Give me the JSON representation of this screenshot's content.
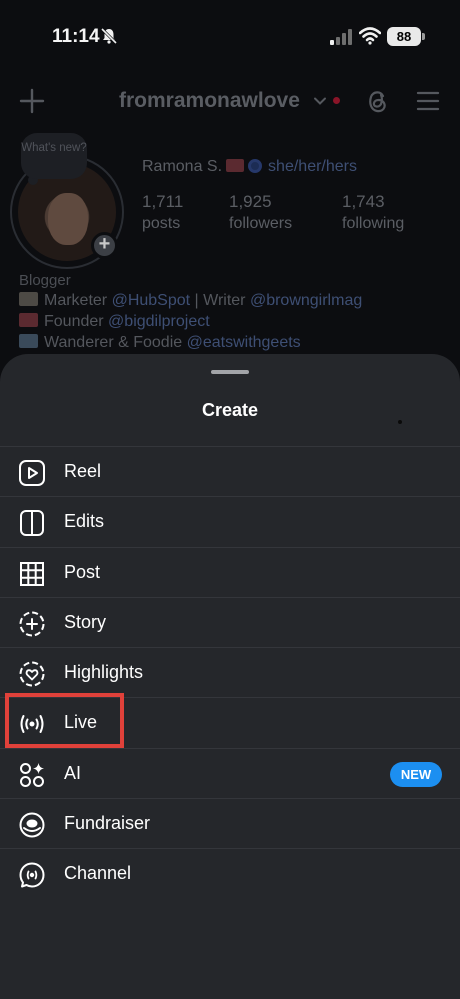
{
  "status_bar": {
    "time": "11:14",
    "battery": "88"
  },
  "profile": {
    "username": "fromramonawlove",
    "note_placeholder": "What's new?",
    "name": "Ramona S.",
    "pronouns": "she/her/hers",
    "stats": [
      {
        "value": "1,711",
        "label": "posts"
      },
      {
        "value": "1,925",
        "label": "followers"
      },
      {
        "value": "1,743",
        "label": "following"
      }
    ],
    "bio_category": "Blogger",
    "bio_lines": [
      {
        "text": "Marketer ",
        "mention": "@HubSpot",
        "rest": " | Writer ",
        "mention2": "@browngirlmag"
      },
      {
        "text": "Founder ",
        "mention": "@bigdilproject"
      },
      {
        "text": "Wanderer & Foodie ",
        "mention": "@eatswithgeets"
      }
    ]
  },
  "sheet": {
    "title": "Create",
    "items": [
      {
        "label": "Reel",
        "icon": "reel-icon"
      },
      {
        "label": "Edits",
        "icon": "edits-icon"
      },
      {
        "label": "Post",
        "icon": "grid-icon"
      },
      {
        "label": "Story",
        "icon": "story-add-icon"
      },
      {
        "label": "Highlights",
        "icon": "highlights-heart-icon"
      },
      {
        "label": "Live",
        "icon": "live-broadcast-icon"
      },
      {
        "label": "AI",
        "icon": "ai-sparkle-icon",
        "badge": "NEW"
      },
      {
        "label": "Fundraiser",
        "icon": "fundraiser-icon"
      },
      {
        "label": "Channel",
        "icon": "channel-icon"
      }
    ]
  },
  "colors": {
    "sheet_bg": "#25272b",
    "badge_blue": "#1c8ff1",
    "highlight_red": "#e0413a"
  }
}
